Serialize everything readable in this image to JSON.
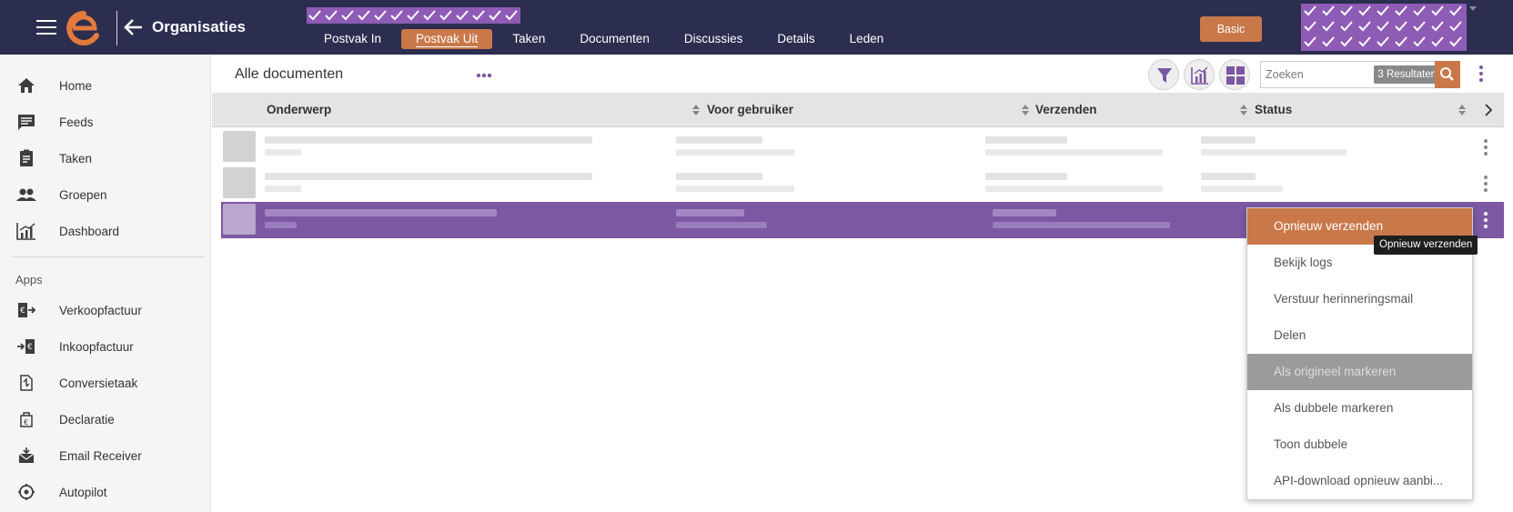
{
  "header": {
    "title": "Organisaties",
    "tabs": [
      {
        "label": "Postvak In",
        "active": false
      },
      {
        "label": "Postvak Uit",
        "active": true
      },
      {
        "label": "Taken",
        "active": false
      },
      {
        "label": "Documenten",
        "active": false
      },
      {
        "label": "Discussies",
        "active": false
      },
      {
        "label": "Details",
        "active": false
      },
      {
        "label": "Leden",
        "active": false
      }
    ],
    "plan_button": "Basic"
  },
  "sidebar": {
    "items": [
      {
        "label": "Home",
        "icon": "home-icon"
      },
      {
        "label": "Feeds",
        "icon": "feeds-icon"
      },
      {
        "label": "Taken",
        "icon": "clipboard-icon"
      },
      {
        "label": "Groepen",
        "icon": "group-icon"
      },
      {
        "label": "Dashboard",
        "icon": "chart-icon"
      }
    ],
    "apps_label": "Apps",
    "apps": [
      {
        "label": "Verkoopfactuur",
        "icon": "sales-invoice-icon"
      },
      {
        "label": "Inkoopfactuur",
        "icon": "purchase-invoice-icon"
      },
      {
        "label": "Conversietaak",
        "icon": "conversion-icon"
      },
      {
        "label": "Declaratie",
        "icon": "expense-icon"
      },
      {
        "label": "Email Receiver",
        "icon": "email-receiver-icon"
      },
      {
        "label": "Autopilot",
        "icon": "autopilot-icon"
      }
    ]
  },
  "main": {
    "title": "Alle documenten",
    "search": {
      "placeholder": "Zoeken",
      "results": "3 Resultaten"
    },
    "columns": [
      "Onderwerp",
      "Voor gebruiker",
      "Verzenden",
      "Status"
    ]
  },
  "context_menu": {
    "items": [
      {
        "label": "Opnieuw verzenden",
        "state": "hover"
      },
      {
        "label": "Bekijk logs",
        "state": "normal"
      },
      {
        "label": "Verstuur herinneringsmail",
        "state": "normal"
      },
      {
        "label": "Delen",
        "state": "normal"
      },
      {
        "label": "Als origineel markeren",
        "state": "disabled"
      },
      {
        "label": "Als dubbele markeren",
        "state": "normal"
      },
      {
        "label": "Toon dubbele",
        "state": "normal"
      },
      {
        "label": "API-download opnieuw aanbi...",
        "state": "normal"
      }
    ],
    "tooltip": "Opnieuw verzenden"
  },
  "colors": {
    "topbar": "#2b2e4f",
    "accent_orange": "#c9784a",
    "accent_purple": "#7c58a3",
    "pattern_purple": "#8e5bb5"
  }
}
